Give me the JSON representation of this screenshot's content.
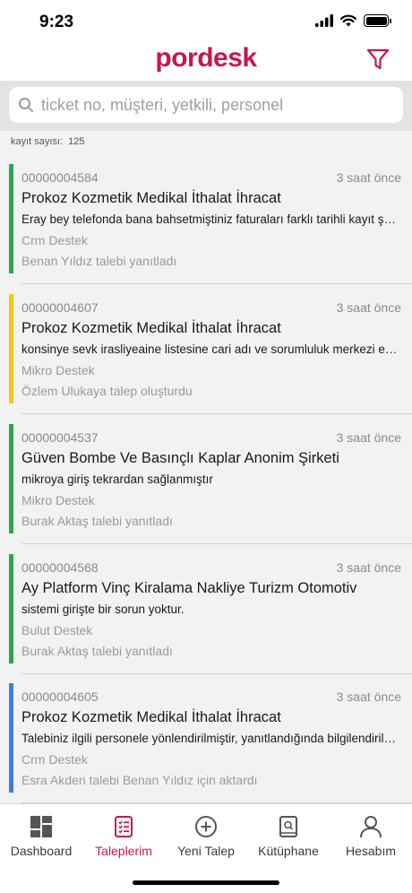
{
  "status": {
    "time": "9:23"
  },
  "header": {
    "logo": "pordesk"
  },
  "search": {
    "placeholder": "ticket no, müşteri, yetkili, personel"
  },
  "count": {
    "label": "kayıt sayısı:",
    "value": "125"
  },
  "tickets": [
    {
      "no": "00000004584",
      "time": "3 saat önce",
      "company": "Prokoz Kozmetik Medikal İthalat İhracat",
      "message": "Eray bey telefonda bana bahsetmiştiniz faturaları farklı tarihli kayıt şeklinde girdik",
      "category": "Crm Destek",
      "activity": "Benan Yıldız talebi yanıtladı",
      "color": "#2ea44f"
    },
    {
      "no": "00000004607",
      "time": "3 saat önce",
      "company": "Prokoz Kozmetik Medikal İthalat İhracat",
      "message": "konsinye sevk irasliyeaine listesine cari adı ve sorumluluk merkezi eklenmesi",
      "category": "Mikro Destek",
      "activity": "Özlem Ulukaya talep oluşturdu",
      "color": "#f5c518"
    },
    {
      "no": "00000004537",
      "time": "3 saat önce",
      "company": "Güven Bombe Ve Basınçlı Kaplar Anonim Şirketi",
      "message": "mikroya giriş tekrardan sağlanmıştır",
      "category": "Mikro Destek",
      "activity": "Burak Aktaş talebi yanıtladı",
      "color": "#2ea44f"
    },
    {
      "no": "00000004568",
      "time": "3 saat önce",
      "company": "Ay Platform Vinç Kiralama Nakliye Turizm Otomotiv",
      "message": "sistemi girişte bir sorun yoktur.",
      "category": "Bulut Destek",
      "activity": "Burak Aktaş talebi yanıtladı",
      "color": "#2ea44f"
    },
    {
      "no": "00000004605",
      "time": "3 saat önce",
      "company": "Prokoz Kozmetik Medikal İthalat İhracat",
      "message": "Talebiniz ilgili personele yönlendirilmiştir, yanıtlandığında bilgilendirileceksiniz",
      "category": "Crm Destek",
      "activity": "Esra Akderi talebi Benan Yıldız için aktardı",
      "color": "#3b7de0"
    }
  ],
  "tabs": [
    {
      "label": "Dashboard",
      "icon": "dashboard-icon"
    },
    {
      "label": "Taleplerim",
      "icon": "tickets-icon"
    },
    {
      "label": "Yeni Talep",
      "icon": "plus-circle-icon"
    },
    {
      "label": "Kütüphane",
      "icon": "library-icon"
    },
    {
      "label": "Hesabım",
      "icon": "user-icon"
    }
  ],
  "colors": {
    "brand": "#c8174a"
  }
}
